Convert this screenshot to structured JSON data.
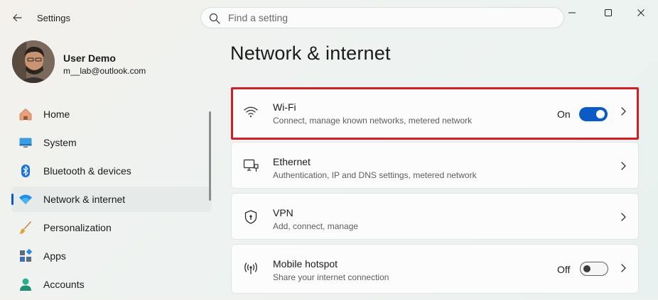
{
  "app": {
    "title": "Settings"
  },
  "search": {
    "placeholder": "Find a setting"
  },
  "user": {
    "name": "User Demo",
    "email": "m__lab@outlook.com"
  },
  "sidebar": {
    "items": [
      {
        "label": "Home",
        "icon": "home-icon"
      },
      {
        "label": "System",
        "icon": "system-icon"
      },
      {
        "label": "Bluetooth & devices",
        "icon": "bluetooth-icon"
      },
      {
        "label": "Network & internet",
        "icon": "network-icon",
        "active": true
      },
      {
        "label": "Personalization",
        "icon": "brush-icon"
      },
      {
        "label": "Apps",
        "icon": "apps-icon"
      },
      {
        "label": "Accounts",
        "icon": "accounts-icon"
      }
    ]
  },
  "page": {
    "title": "Network & internet"
  },
  "cards": [
    {
      "title": "Wi-Fi",
      "description": "Connect, manage known networks, metered network",
      "state": "On",
      "toggle": "on",
      "icon": "wifi-icon"
    },
    {
      "title": "Ethernet",
      "description": "Authentication, IP and DNS settings, metered network",
      "icon": "ethernet-icon"
    },
    {
      "title": "VPN",
      "description": "Add, connect, manage",
      "icon": "vpn-shield-icon"
    },
    {
      "title": "Mobile hotspot",
      "description": "Share your internet connection",
      "state": "Off",
      "toggle": "off",
      "icon": "hotspot-icon"
    }
  ],
  "colors": {
    "accent": "#0a5bc4",
    "highlight": "#d01f26"
  }
}
